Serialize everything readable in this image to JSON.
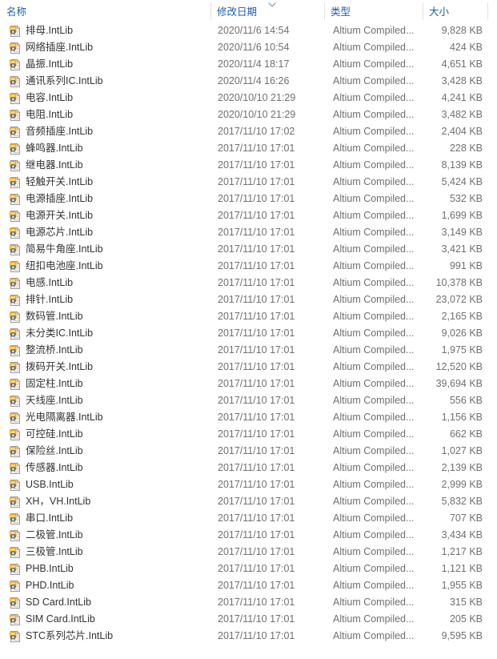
{
  "window": {
    "title": "File list",
    "background": "#ffffff"
  },
  "colors": {
    "header_text": "#1e5fa8",
    "row_text": "#333333",
    "secondary_text": "#707070",
    "divider": "#e2e2e2",
    "icon_accent": "#f0a30a",
    "icon_body": "#f5f5f5",
    "icon_chip": "#4a4a4a"
  },
  "columns": [
    {
      "key": "name",
      "label": "名称",
      "align": "left",
      "sorted": false
    },
    {
      "key": "date",
      "label": "修改日期",
      "align": "left",
      "sorted": true,
      "sort_direction": "descending",
      "sort_icon": "chevron-down-icon"
    },
    {
      "key": "type",
      "label": "类型",
      "align": "left",
      "sorted": false
    },
    {
      "key": "size",
      "label": "大小",
      "align": "right",
      "sorted": false
    }
  ],
  "file_type_label": "Altium Compiled...",
  "file_icon_name": "altium-intlib-file-icon",
  "rows": [
    {
      "name": "排母.IntLib",
      "date": "2020/11/6 14:54",
      "type": "Altium Compiled...",
      "size": "9,828 KB"
    },
    {
      "name": "网络插座.IntLib",
      "date": "2020/11/6 10:54",
      "type": "Altium Compiled...",
      "size": "424 KB"
    },
    {
      "name": "晶振.IntLib",
      "date": "2020/11/4 18:17",
      "type": "Altium Compiled...",
      "size": "4,651 KB"
    },
    {
      "name": "通讯系列IC.IntLib",
      "date": "2020/11/4 16:26",
      "type": "Altium Compiled...",
      "size": "3,428 KB"
    },
    {
      "name": "电容.IntLib",
      "date": "2020/10/10 21:29",
      "type": "Altium Compiled...",
      "size": "4,241 KB"
    },
    {
      "name": "电阻.IntLib",
      "date": "2020/10/10 21:29",
      "type": "Altium Compiled...",
      "size": "3,482 KB"
    },
    {
      "name": "音频插座.IntLib",
      "date": "2017/11/10 17:02",
      "type": "Altium Compiled...",
      "size": "2,404 KB"
    },
    {
      "name": "蜂鸣器.IntLib",
      "date": "2017/11/10 17:01",
      "type": "Altium Compiled...",
      "size": "228 KB"
    },
    {
      "name": "继电器.IntLib",
      "date": "2017/11/10 17:01",
      "type": "Altium Compiled...",
      "size": "8,139 KB"
    },
    {
      "name": "轻触开关.IntLib",
      "date": "2017/11/10 17:01",
      "type": "Altium Compiled...",
      "size": "5,424 KB"
    },
    {
      "name": "电源插座.IntLib",
      "date": "2017/11/10 17:01",
      "type": "Altium Compiled...",
      "size": "532 KB"
    },
    {
      "name": "电源开关.IntLib",
      "date": "2017/11/10 17:01",
      "type": "Altium Compiled...",
      "size": "1,699 KB"
    },
    {
      "name": "电源芯片.IntLib",
      "date": "2017/11/10 17:01",
      "type": "Altium Compiled...",
      "size": "3,149 KB"
    },
    {
      "name": "简易牛角座.IntLib",
      "date": "2017/11/10 17:01",
      "type": "Altium Compiled...",
      "size": "3,421 KB"
    },
    {
      "name": "纽扣电池座.IntLib",
      "date": "2017/11/10 17:01",
      "type": "Altium Compiled...",
      "size": "991 KB"
    },
    {
      "name": "电感.IntLib",
      "date": "2017/11/10 17:01",
      "type": "Altium Compiled...",
      "size": "10,378 KB"
    },
    {
      "name": "排针.IntLib",
      "date": "2017/11/10 17:01",
      "type": "Altium Compiled...",
      "size": "23,072 KB"
    },
    {
      "name": "数码管.IntLib",
      "date": "2017/11/10 17:01",
      "type": "Altium Compiled...",
      "size": "2,165 KB"
    },
    {
      "name": "未分类IC.IntLib",
      "date": "2017/11/10 17:01",
      "type": "Altium Compiled...",
      "size": "9,026 KB"
    },
    {
      "name": "整流桥.IntLib",
      "date": "2017/11/10 17:01",
      "type": "Altium Compiled...",
      "size": "1,975 KB"
    },
    {
      "name": "拨码开关.IntLib",
      "date": "2017/11/10 17:01",
      "type": "Altium Compiled...",
      "size": "12,520 KB"
    },
    {
      "name": "固定柱.IntLib",
      "date": "2017/11/10 17:01",
      "type": "Altium Compiled...",
      "size": "39,694 KB"
    },
    {
      "name": "天线座.IntLib",
      "date": "2017/11/10 17:01",
      "type": "Altium Compiled...",
      "size": "556 KB"
    },
    {
      "name": "光电隔离器.IntLib",
      "date": "2017/11/10 17:01",
      "type": "Altium Compiled...",
      "size": "1,156 KB"
    },
    {
      "name": "可控硅.IntLib",
      "date": "2017/11/10 17:01",
      "type": "Altium Compiled...",
      "size": "662 KB"
    },
    {
      "name": "保险丝.IntLib",
      "date": "2017/11/10 17:01",
      "type": "Altium Compiled...",
      "size": "1,027 KB"
    },
    {
      "name": "传感器.IntLib",
      "date": "2017/11/10 17:01",
      "type": "Altium Compiled...",
      "size": "2,139 KB"
    },
    {
      "name": "USB.IntLib",
      "date": "2017/11/10 17:01",
      "type": "Altium Compiled...",
      "size": "2,999 KB"
    },
    {
      "name": "XH，VH.IntLib",
      "date": "2017/11/10 17:01",
      "type": "Altium Compiled...",
      "size": "5,832 KB"
    },
    {
      "name": "串口.IntLib",
      "date": "2017/11/10 17:01",
      "type": "Altium Compiled...",
      "size": "707 KB"
    },
    {
      "name": "二极管.IntLib",
      "date": "2017/11/10 17:01",
      "type": "Altium Compiled...",
      "size": "3,434 KB"
    },
    {
      "name": "三极管.IntLib",
      "date": "2017/11/10 17:01",
      "type": "Altium Compiled...",
      "size": "1,217 KB"
    },
    {
      "name": "PHB.IntLib",
      "date": "2017/11/10 17:01",
      "type": "Altium Compiled...",
      "size": "1,121 KB"
    },
    {
      "name": "PHD.IntLib",
      "date": "2017/11/10 17:01",
      "type": "Altium Compiled...",
      "size": "1,955 KB"
    },
    {
      "name": "SD Card.IntLib",
      "date": "2017/11/10 17:01",
      "type": "Altium Compiled...",
      "size": "315 KB"
    },
    {
      "name": "SIM Card.IntLib",
      "date": "2017/11/10 17:01",
      "type": "Altium Compiled...",
      "size": "205 KB"
    },
    {
      "name": "STC系列芯片.IntLib",
      "date": "2017/11/10 17:01",
      "type": "Altium Compiled...",
      "size": "9,595 KB"
    }
  ]
}
